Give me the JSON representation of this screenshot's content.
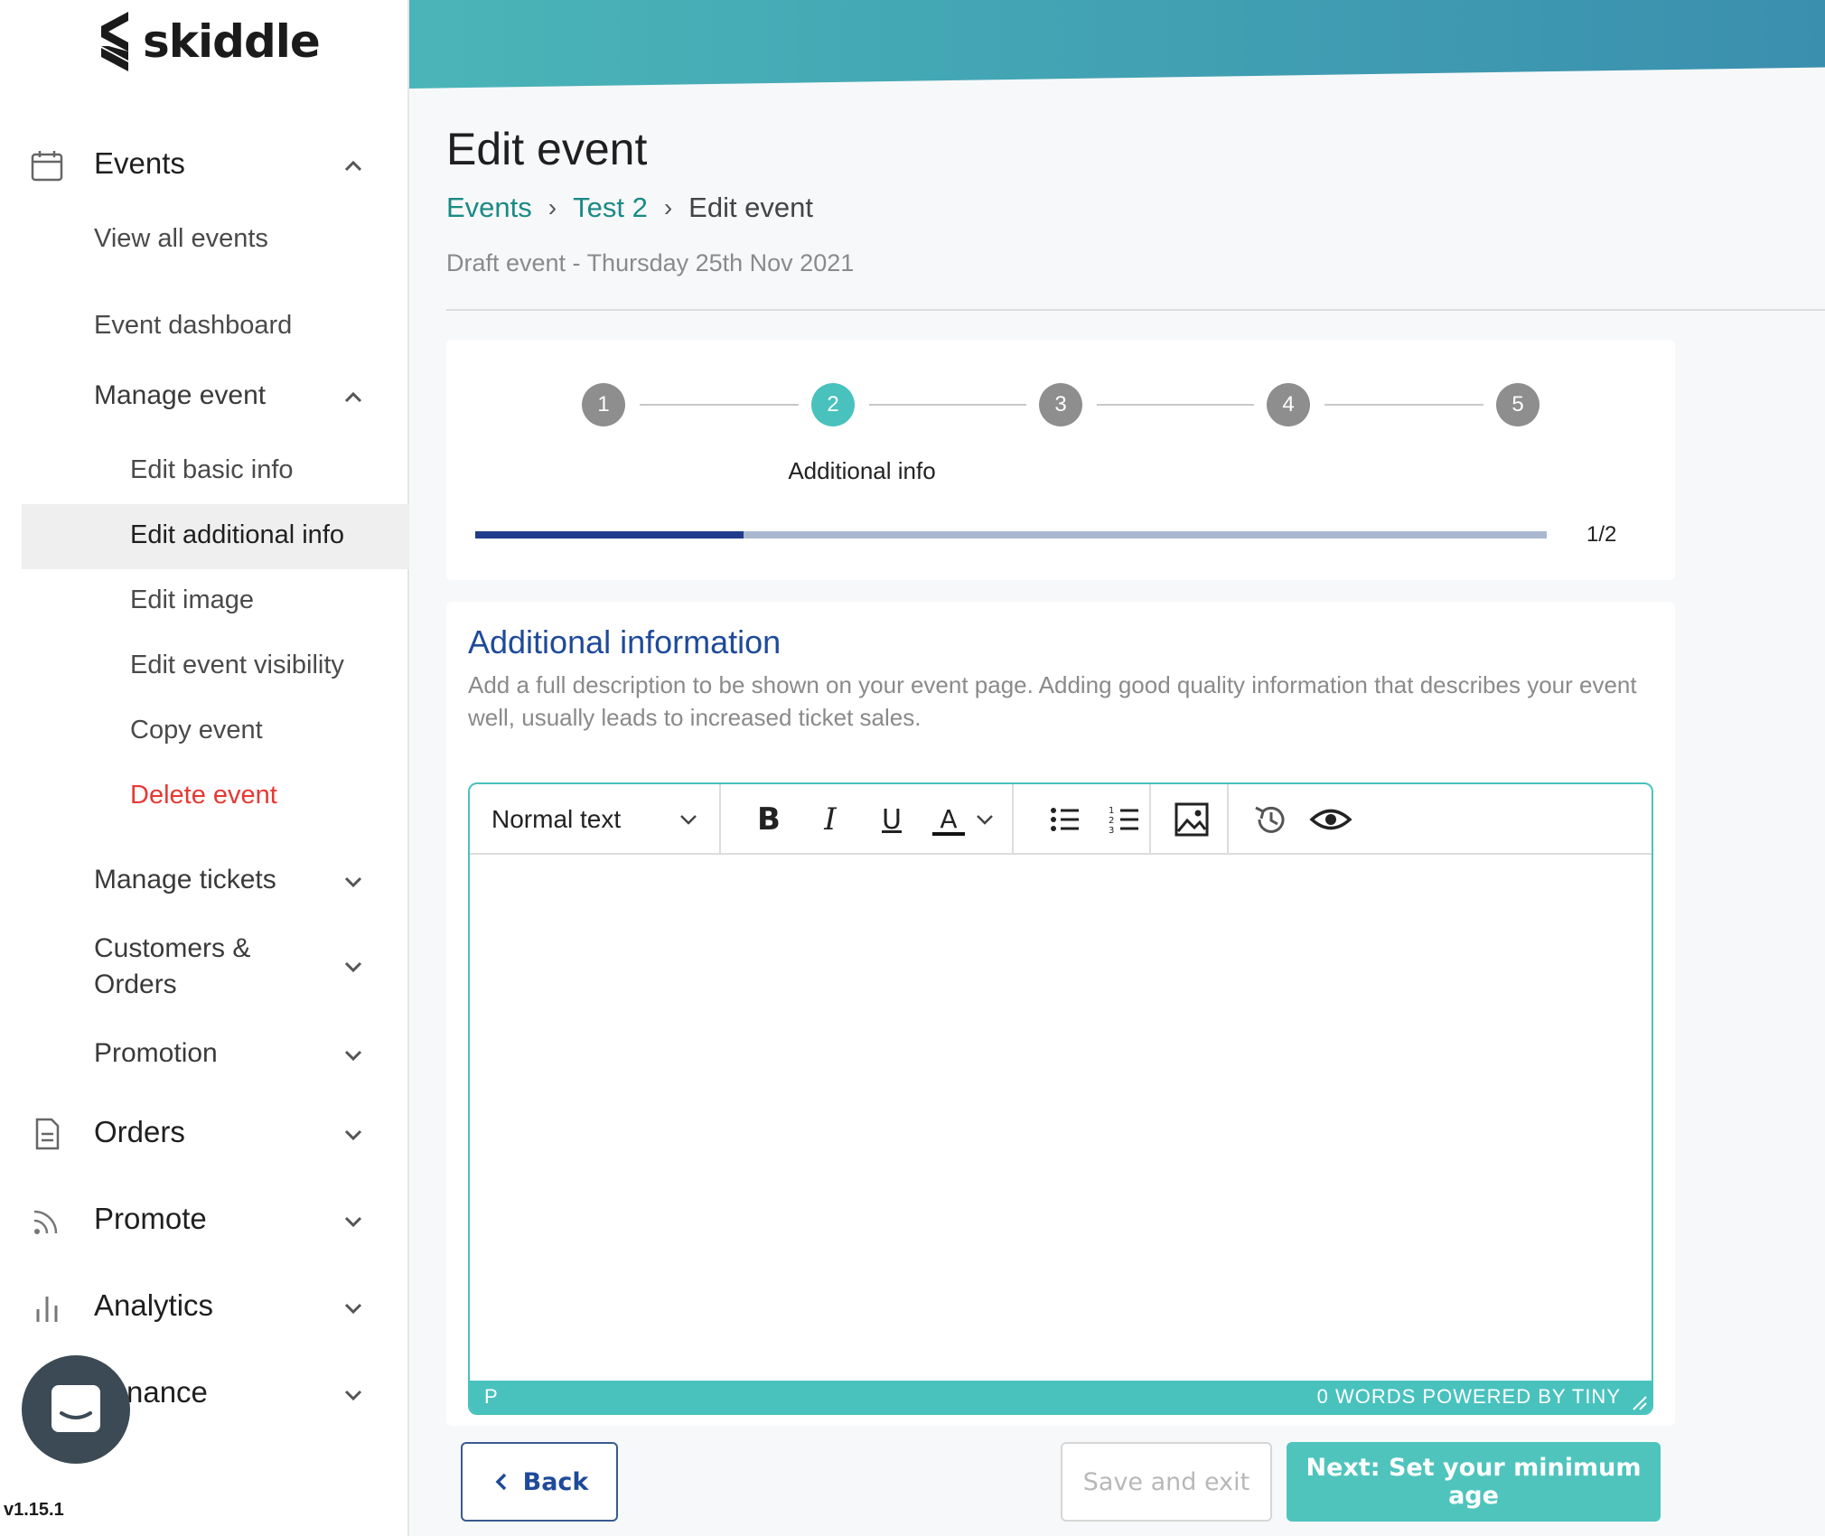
{
  "brand": {
    "name": "skiddle",
    "accent": "#49c2be",
    "primary": "#1e4a9a"
  },
  "sidebar": {
    "events": {
      "label": "Events",
      "icon": "calendar-icon",
      "view_all": "View all events",
      "dashboard": "Event dashboard",
      "manage_event": {
        "label": "Manage event",
        "items": [
          "Edit basic info",
          "Edit additional info",
          "Edit image",
          "Edit event visibility",
          "Copy event",
          "Delete event"
        ],
        "active_item": "Edit additional info"
      },
      "manage_tickets": "Manage tickets",
      "customers_orders_line1": "Customers &",
      "customers_orders_line2": "Orders",
      "promotion": "Promotion"
    },
    "orders": {
      "label": "Orders",
      "icon": "document-icon"
    },
    "promote": {
      "label": "Promote",
      "icon": "rss-icon"
    },
    "analytics": {
      "label": "Analytics",
      "icon": "bar-chart-icon"
    },
    "finance": {
      "label": "Finance",
      "visible_text": "nance"
    },
    "version": "v1.15.1"
  },
  "page": {
    "title": "Edit event",
    "breadcrumb": [
      "Events",
      "Test 2",
      "Edit event"
    ],
    "breadcrumb_sep": "›",
    "draft_line": "Draft event - Thursday 25th Nov 2021"
  },
  "stepper": {
    "steps": [
      "1",
      "2",
      "3",
      "4",
      "5"
    ],
    "active_step": 2,
    "active_label": "Additional info",
    "progress_fraction": 0.25,
    "progress_text": "1/2"
  },
  "info": {
    "title": "Additional information",
    "description": "Add a full description to be shown on your event page. Adding good quality information that describes your event well, usually leads to increased ticket sales."
  },
  "editor": {
    "format_select": "Normal text",
    "tools": {
      "bold": "B",
      "italic": "I",
      "underline": "U",
      "text_color": "A"
    },
    "status_element": "P",
    "status_right": "0 WORDS  POWERED BY TINY"
  },
  "footer": {
    "back": "Back",
    "save_exit": "Save and exit",
    "next": "Next: Set your minimum age"
  }
}
